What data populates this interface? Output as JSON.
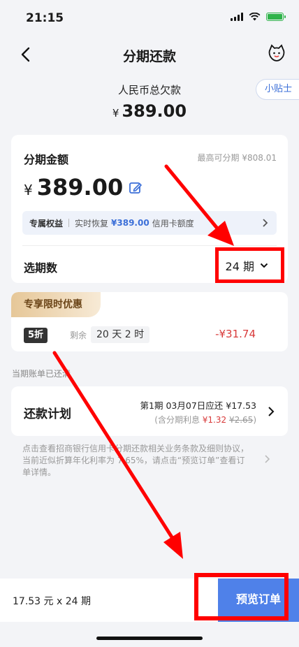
{
  "status_bar": {
    "time": "21:15"
  },
  "nav": {
    "title": "分期还款"
  },
  "tip": {
    "label": "小贴士"
  },
  "total": {
    "label": "人民币总欠款",
    "currency": "¥",
    "amount": "389.00"
  },
  "installment": {
    "title": "分期金额",
    "max_text": "最高可分期 ¥808.01",
    "currency": "¥",
    "amount": "389.00",
    "benefit": {
      "tag": "专属权益",
      "prefix": "实时恢复",
      "amount": "¥389.00",
      "suffix": "信用卡额度"
    },
    "term_label": "选期数",
    "term_value": "24 期"
  },
  "offer": {
    "ribbon": "专享限时优惠",
    "discount": "5折",
    "remain_label": "剩余",
    "remain_time": "20 天 2 时",
    "saving": "-¥31.74"
  },
  "bill_status": "当期账单已还清",
  "plan": {
    "label": "还款计划",
    "line1": "第1期 03月07日应还 ¥17.53",
    "line2_prefix": "(含分期利息 ",
    "interest": "¥1.32",
    "original_interest": "¥2.65",
    "line2_suffix": ")"
  },
  "notice": "点击查看招商银行信用卡分期还款相关业务条款及细则协议，当前近似折算年化利率为 7.65%，请点击“预览订单”查看订单详情。",
  "bottom": {
    "summary": "17.53 元 x 24 期",
    "preview_label": "预览订单"
  },
  "colors": {
    "accent": "#4f81e9",
    "warning": "#d83a3a",
    "annotation": "#ff0000"
  }
}
